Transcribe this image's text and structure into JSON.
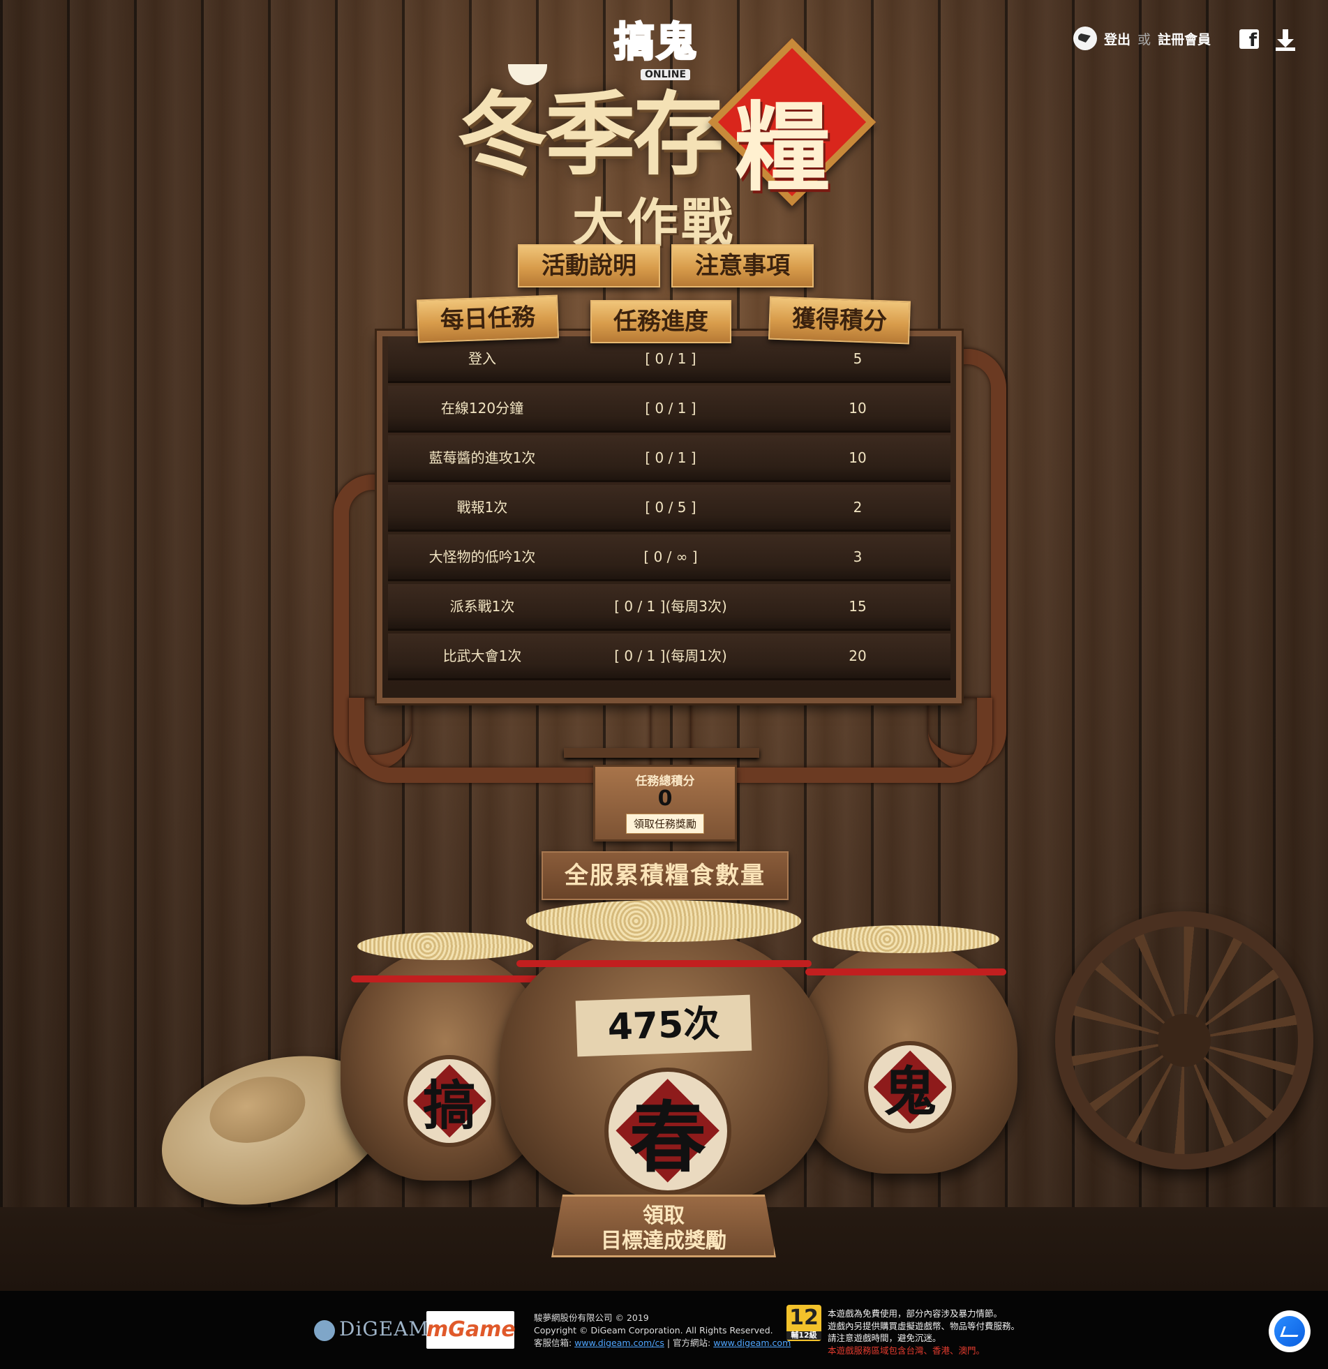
{
  "header": {
    "login_label": "登出",
    "or_label": "或",
    "register_label": "註冊會員",
    "facebook_icon": "facebook-icon",
    "download_icon": "download-icon"
  },
  "logo": {
    "game_name": "搞鬼",
    "online_label": "ONLINE"
  },
  "title": {
    "main": "冬季存",
    "highlight": "糧",
    "sub": "大作戰"
  },
  "buttons": {
    "event_description": "活動說明",
    "notes": "注意事項"
  },
  "table": {
    "headers": [
      "每日任務",
      "任務進度",
      "獲得積分"
    ],
    "rows": [
      {
        "task": "登入",
        "progress": "[ 0 / 1 ]",
        "points": "5"
      },
      {
        "task": "在線120分鐘",
        "progress": "[ 0 / 1 ]",
        "points": "10"
      },
      {
        "task": "藍莓醬的進攻1次",
        "progress": "[ 0 / 1 ]",
        "points": "10"
      },
      {
        "task": "戰報1次",
        "progress": "[ 0 / 5 ]",
        "points": "2"
      },
      {
        "task": "大怪物的低吟1次",
        "progress": "[ 0 / ∞ ]",
        "points": "3"
      },
      {
        "task": "派系戰1次",
        "progress": "[ 0 / 1 ](每周3次)",
        "points": "15"
      },
      {
        "task": "比武大會1次",
        "progress": "[ 0 / 1 ](每周1次)",
        "points": "20"
      }
    ]
  },
  "total": {
    "label": "任務總積分",
    "value": "0",
    "claim_label": "領取任務獎勵"
  },
  "server": {
    "label": "全服累積糧食數量",
    "count": "475次",
    "jar_left_char": "搞",
    "jar_center_char": "春",
    "jar_right_char": "鬼",
    "reward_line1": "領取",
    "reward_line2": "目標達成獎勵"
  },
  "footer": {
    "digeam_logo": "DiGEAM",
    "mgame_logo": "mGame",
    "company": "駿夢網股份有限公司 © 2019",
    "copyright": "Copyright © DiGeam Corporation. All Rights Reserved.",
    "cs_label": "客服信箱:",
    "cs_link": "www.digeam.com/cs",
    "official_label": "官方網站:",
    "official_link": "www.digeam.com",
    "rating_number": "12",
    "rating_label": "輔12級",
    "notice1": "本遊戲為免費使用，部分內容涉及暴力情節。",
    "notice2": "遊戲內另提供購買虛擬遊戲幣、物品等付費服務。",
    "notice3": "請注意遊戲時間，避免沉迷。",
    "notice4": "本遊戲服務區域包含台灣、香港、澳門。"
  },
  "colors": {
    "accent_red": "#d9261c",
    "wood": "#6b4a30",
    "link": "#4ea5ff"
  }
}
